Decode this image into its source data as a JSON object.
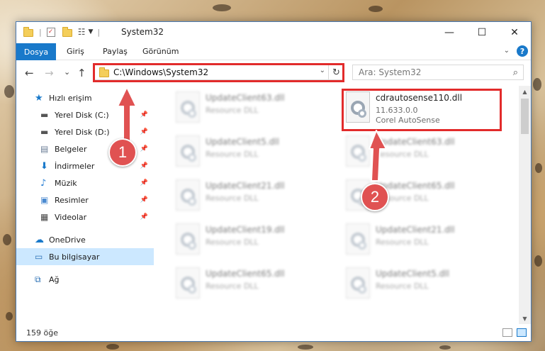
{
  "window": {
    "title": "System32",
    "controls": {
      "minimize": "—",
      "maximize": "☐",
      "close": "✕"
    }
  },
  "ribbon": {
    "tabs": [
      "Dosya",
      "Giriş",
      "Paylaş",
      "Görünüm"
    ],
    "help": "?"
  },
  "navigation": {
    "back": "←",
    "forward": "→",
    "recent": "⌄",
    "up": "↑",
    "address": "C:\\Windows\\System32",
    "refresh": "↻",
    "search_placeholder": "Ara: System32"
  },
  "sidebar": {
    "items": [
      {
        "label": "Hızlı erişim",
        "icon": "star-icon",
        "pinned": false,
        "selected": false
      },
      {
        "label": "Yerel Disk (C:)",
        "icon": "drive-icon",
        "pinned": true,
        "selected": false
      },
      {
        "label": "Yerel Disk (D:)",
        "icon": "drive-icon",
        "pinned": true,
        "selected": false
      },
      {
        "label": "Belgeler",
        "icon": "documents-icon",
        "pinned": true,
        "selected": false
      },
      {
        "label": "İndirmeler",
        "icon": "download-icon",
        "pinned": true,
        "selected": false
      },
      {
        "label": "Müzik",
        "icon": "music-icon",
        "pinned": true,
        "selected": false
      },
      {
        "label": "Resimler",
        "icon": "pictures-icon",
        "pinned": true,
        "selected": false
      },
      {
        "label": "Videolar",
        "icon": "video-icon",
        "pinned": true,
        "selected": false
      },
      {
        "label": "OneDrive",
        "icon": "cloud-icon",
        "pinned": false,
        "selected": false
      },
      {
        "label": "Bu bilgisayar",
        "icon": "computer-icon",
        "pinned": false,
        "selected": true
      },
      {
        "label": "Ağ",
        "icon": "network-icon",
        "pinned": false,
        "selected": false
      }
    ]
  },
  "files": {
    "left_column": [
      {
        "name": "UpdateClient63.dll",
        "type": "Resource DLL"
      },
      {
        "name": "UpdateClient5.dll",
        "type": "Resource DLL"
      },
      {
        "name": "UpdateClient21.dll",
        "type": "Resource DLL"
      },
      {
        "name": "UpdateClient19.dll",
        "type": "Resource DLL"
      },
      {
        "name": "UpdateClient65.dll",
        "type": "Resource DLL"
      }
    ],
    "highlighted": {
      "name": "cdrautosense110.dll",
      "version": "11.633.0.0",
      "company": "Corel AutoSense"
    },
    "right_column": [
      {
        "name": "UpdateClient63.dll",
        "type": "Resource DLL"
      },
      {
        "name": "UpdateClient65.dll",
        "type": "Resource DLL"
      },
      {
        "name": "UpdateClient21.dll",
        "type": "Resource DLL"
      },
      {
        "name": "UpdateClient5.dll",
        "type": "Resource DLL"
      }
    ]
  },
  "status": {
    "item_count": "159 öğe"
  },
  "annotations": {
    "marker1": "1",
    "marker2": "2",
    "highlight_color": "#e22b2b",
    "marker_color": "#e05252"
  },
  "colors": {
    "accent": "#1979ca",
    "selection": "#cce8ff"
  }
}
